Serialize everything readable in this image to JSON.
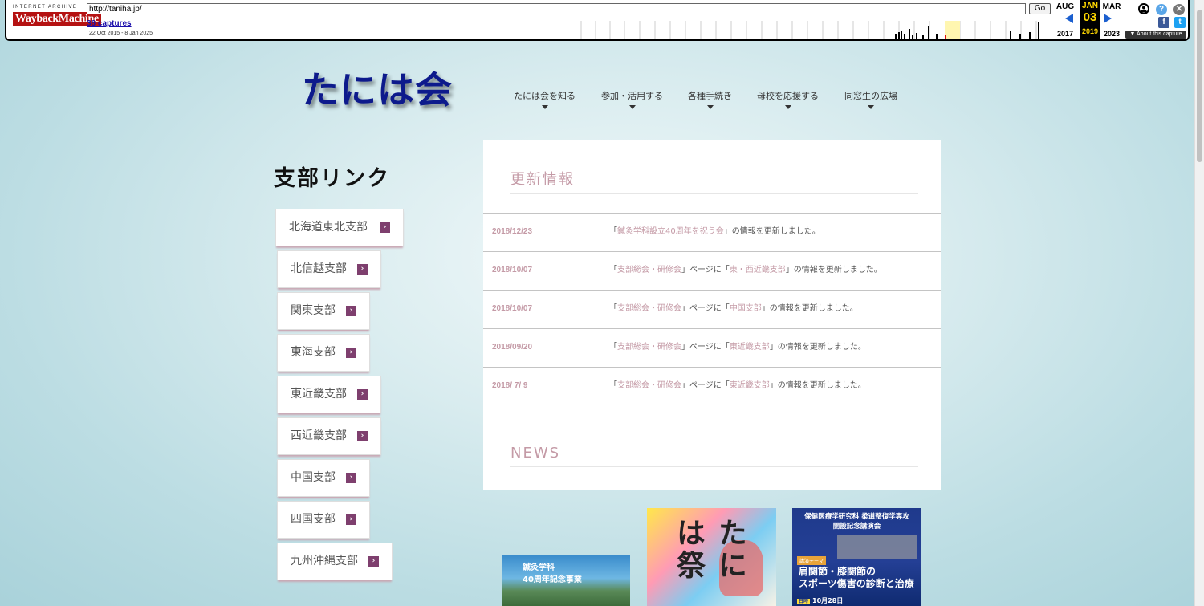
{
  "wayback": {
    "logo_top": "INTERNET ARCHIVE",
    "logo_main": "WaybackMachine",
    "url": "http://taniha.jp/",
    "go_label": "Go",
    "captures_label": "36 captures",
    "date_range": "22 Oct 2015 - 8 Jan 2025",
    "prev_month": "AUG",
    "prev_year": "2017",
    "current_month": "JAN",
    "current_day": "03",
    "current_year": "2019",
    "next_month": "MAR",
    "next_year": "2023",
    "about_label": "▼ About this capture",
    "facebook_icon": "f",
    "twitter_icon": "t",
    "help_icon": "?",
    "close_icon": "✕",
    "accent_color": "#1b5fcf",
    "current_highlight": "#ffd800"
  },
  "site": {
    "logo_text": "たには会",
    "nav": [
      {
        "label": "たには会を知る"
      },
      {
        "label": "参加・活用する"
      },
      {
        "label": "各種手続き"
      },
      {
        "label": "母校を応援する"
      },
      {
        "label": "同窓生の広場"
      }
    ]
  },
  "branches": {
    "title": "支部リンク",
    "items": [
      {
        "label": "北海道東北支部"
      },
      {
        "label": "北信越支部"
      },
      {
        "label": "関東支部"
      },
      {
        "label": "東海支部"
      },
      {
        "label": "東近畿支部"
      },
      {
        "label": "西近畿支部"
      },
      {
        "label": "中国支部"
      },
      {
        "label": "四国支部"
      },
      {
        "label": "九州沖縄支部"
      }
    ],
    "arrow_glyph": "›",
    "arrow_color": "#7e3f6e"
  },
  "updates": {
    "title": "更新情報",
    "rows": [
      {
        "date": "2018/12/23",
        "p1": "「",
        "l1": "鍼灸学科設立40周年を祝う会",
        "p2": "」の情報を更新しました。",
        "l2": "",
        "p3": ""
      },
      {
        "date": "2018/10/07",
        "p1": "「",
        "l1": "支部総会・研修会",
        "p2": "」ページに「",
        "l2": "東・西近畿支部",
        "p3": "」の情報を更新しました。"
      },
      {
        "date": "2018/10/07",
        "p1": "「",
        "l1": "支部総会・研修会",
        "p2": "」ページに「",
        "l2": "中国支部",
        "p3": "」の情報を更新しました。"
      },
      {
        "date": "2018/09/20",
        "p1": "「",
        "l1": "支部総会・研修会",
        "p2": "」ページに「",
        "l2": "東近畿支部",
        "p3": "」の情報を更新しました。"
      },
      {
        "date": "2018/ 7/ 9",
        "p1": "「",
        "l1": "支部総会・研修会",
        "p2": "」ページに「",
        "l2": "東近畿支部",
        "p3": "」の情報を更新しました。"
      }
    ],
    "accent_color": "#c49aa6"
  },
  "news": {
    "title": "NEWS"
  },
  "banners": {
    "shinkyu": {
      "line1": "鍼灸学科",
      "line2": "40周年記念事業"
    },
    "matsuri": {
      "title": "たには祭"
    },
    "kouza": {
      "heading1": "保健医療学研究科 柔道整復学専攻",
      "heading2": "開設記念講演会",
      "tag": "講演テーマ",
      "main1": "肩関節・膝関節の",
      "main2": "スポーツ傷害の診断と治療",
      "date_tag": "日時",
      "date": "10月28日"
    }
  }
}
